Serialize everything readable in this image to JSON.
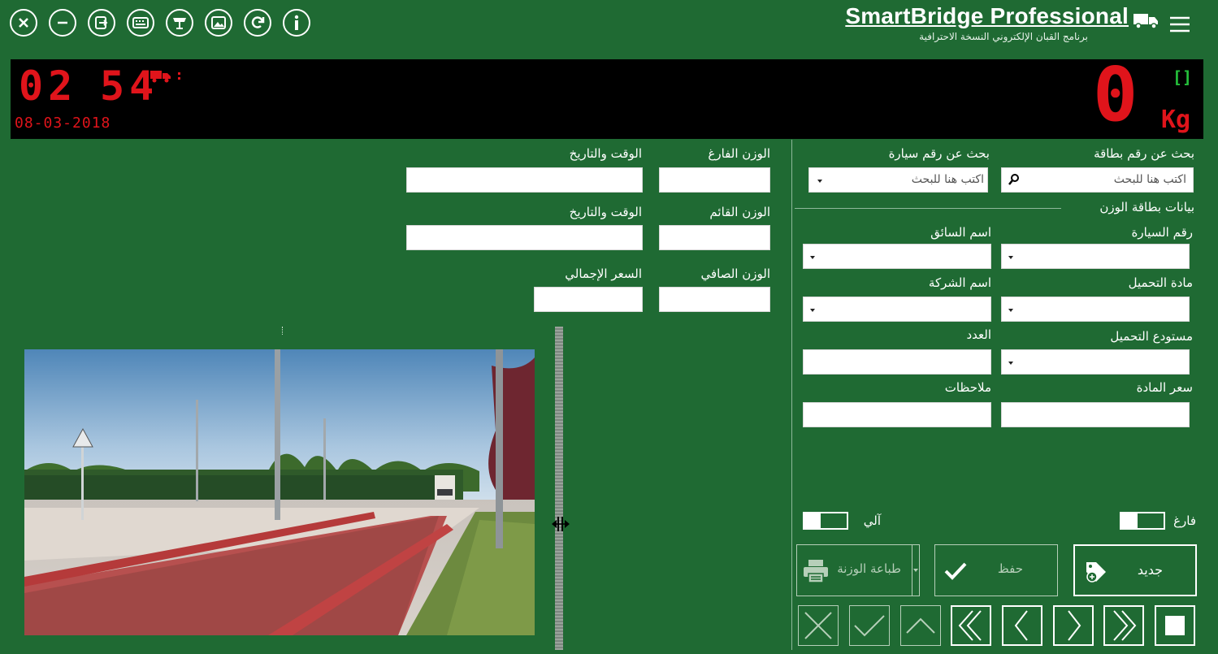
{
  "app": {
    "title": "SmartBridge Professional",
    "subtitle": "برنامج القبان الإلكتروني النسخة الاحترافية"
  },
  "toolbar": {
    "icons": [
      "close-icon",
      "minimize-icon",
      "exit-icon",
      "keyboard-icon",
      "scale-icon",
      "image-icon",
      "refresh-icon",
      "info-icon"
    ],
    "right_icons": [
      "truck-icon",
      "menu-icon"
    ]
  },
  "display": {
    "hours": "02",
    "minutes": "54",
    "date": "08-03-2018",
    "weight": "0",
    "unit": "Kg",
    "status_bracket": "[]",
    "accent_red": "#e0141b",
    "accent_green": "#25c23c"
  },
  "weights": {
    "empty_label": "الوزن الفارغ",
    "empty_datetime_label": "الوقت والتاريخ",
    "loaded_label": "الوزن القائم",
    "loaded_datetime_label": "الوقت والتاريخ",
    "net_label": "الوزن الصافي",
    "total_price_label": "السعر الإجمالي"
  },
  "search": {
    "card_label": "بحث عن رقم بطاقة",
    "card_placeholder": "اكتب هنا للبحث",
    "vehicle_label": "بحث عن رقم سيارة",
    "vehicle_placeholder": "اكتب هنا للبحث"
  },
  "card": {
    "section_title": "بيانات بطاقة الوزن",
    "vehicle_no": "رقم السيارة",
    "driver": "اسم السائق",
    "material": "مادة التحميل",
    "company": "اسم الشركة",
    "warehouse": "مستودع التحميل",
    "count": "العدد",
    "price": "سعر المادة",
    "notes": "ملاحظات"
  },
  "toggles": {
    "empty": "فارغ",
    "auto": "آلي"
  },
  "actions": {
    "new": "جديد",
    "save": "حفظ",
    "print": "طباعة الوزنة"
  },
  "nav_icons": [
    "stop-icon",
    "last-icon",
    "next-icon",
    "previous-icon",
    "first-icon",
    "up-icon",
    "confirm-icon",
    "cancel-icon"
  ],
  "theme": {
    "background": "#1f6a33",
    "panel_border": "#b6cfb9"
  }
}
